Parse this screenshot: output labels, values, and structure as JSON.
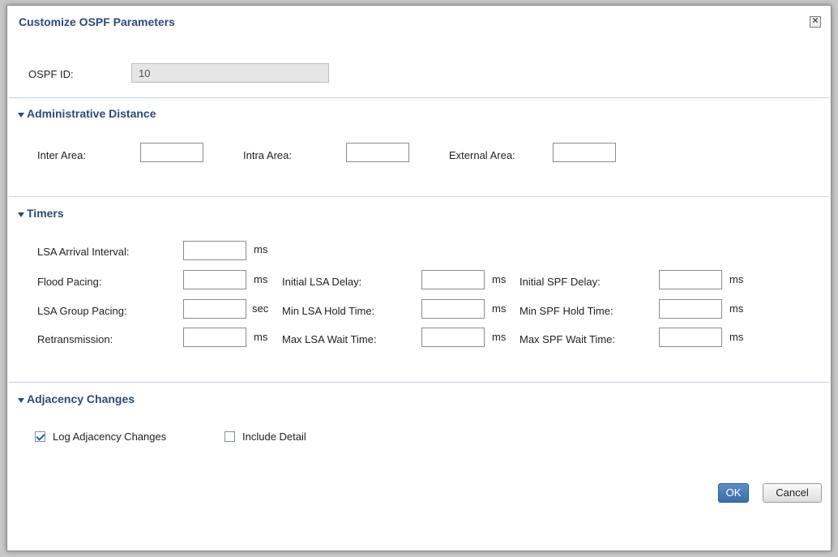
{
  "dialog": {
    "title": "Customize OSPF Parameters",
    "close_icon": "close-icon"
  },
  "ospf": {
    "id_label": "OSPF ID:",
    "id_value": "10"
  },
  "admin": {
    "heading": "Administrative Distance",
    "inter_label": "Inter Area:",
    "intra_label": "Intra Area:",
    "external_label": "External Area:"
  },
  "timers": {
    "heading": "Timers",
    "lsa_arrival_label": "LSA Arrival Interval:",
    "flood_pacing_label": "Flood Pacing:",
    "lsa_group_pacing_label": "LSA Group Pacing:",
    "retransmission_label": "Retransmission:",
    "initial_lsa_delay_label": "Initial LSA Delay:",
    "min_lsa_hold_label": "Min LSA Hold Time:",
    "max_lsa_wait_label": "Max LSA Wait Time:",
    "initial_spf_delay_label": "Initial SPF Delay:",
    "min_spf_hold_label": "Min SPF Hold Time:",
    "max_spf_wait_label": "Max SPF Wait Time:",
    "unit_ms": "ms",
    "unit_sec": "sec"
  },
  "adjacency": {
    "heading": "Adjacency Changes",
    "log_label": "Log Adjacency Changes",
    "log_checked": true,
    "detail_label": "Include Detail",
    "detail_checked": false
  },
  "buttons": {
    "ok": "OK",
    "cancel": "Cancel"
  },
  "colors": {
    "accent": "#2f4a78",
    "ok_button": "#3a6ea8",
    "separator": "#c5d4e3"
  }
}
